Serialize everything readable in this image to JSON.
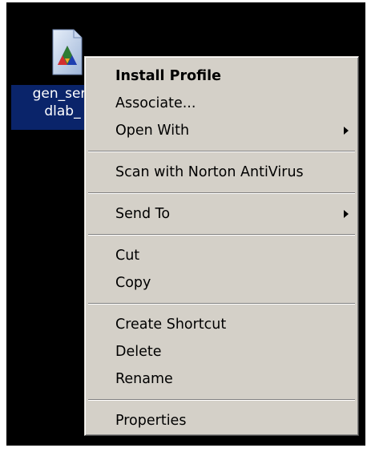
{
  "file": {
    "icon": "icc-profile-file-icon",
    "label_line1": "gen_ser",
    "label_line2": "dlab_"
  },
  "menu": {
    "install_profile": "Install Profile",
    "associate": "Associate...",
    "open_with": "Open With",
    "scan": "Scan with Norton AntiVirus",
    "send_to": "Send To",
    "cut": "Cut",
    "copy": "Copy",
    "create_shortcut": "Create Shortcut",
    "delete": "Delete",
    "rename": "Rename",
    "properties": "Properties"
  },
  "colors": {
    "desktop": "#000000",
    "selection": "#0a246a",
    "menu_bg": "#d4d0c8"
  }
}
